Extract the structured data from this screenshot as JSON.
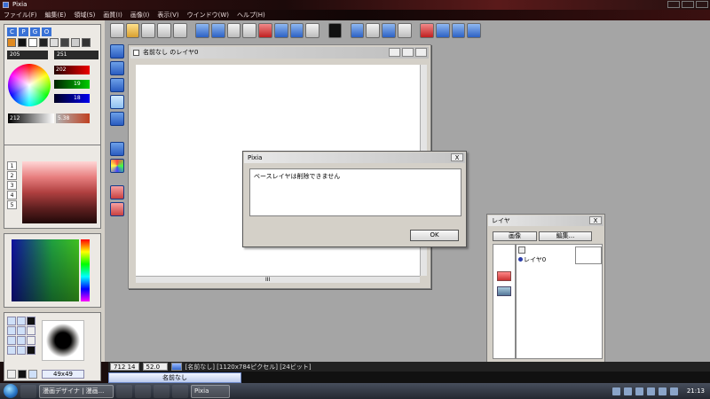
{
  "app": {
    "title": "Pixia"
  },
  "menu": [
    "ファイル(F)",
    "編集(E)",
    "領域(S)",
    "画質(I)",
    "画像(I)",
    "表示(V)",
    "ウインドウ(W)",
    "ヘルプ(H)"
  ],
  "left_panel": {
    "mode_buttons": [
      "C",
      "P",
      "G",
      "O"
    ],
    "field1": "205",
    "field2": "251",
    "rgb": [
      "202",
      "19",
      "18"
    ],
    "gray_value": "212",
    "gray_value2": "5.38",
    "palette_rows": [
      "1",
      "2",
      "3",
      "4",
      "5"
    ],
    "brush_size": "49x49"
  },
  "document": {
    "title": "名前なし のレイヤ0",
    "hscroll_mark": "III"
  },
  "dialog": {
    "title": "Pixia",
    "message": "ベースレイヤは削除できません",
    "ok": "OK",
    "close": "X"
  },
  "layer_window": {
    "title": "レイヤ",
    "btn1": "画像",
    "btn2": "編集...",
    "layer_name": "レイヤ0",
    "close": "X"
  },
  "status": {
    "coords": "712 14",
    "zoom": "52.0",
    "info": "[名前なし] [1120x784ピクセル] [24ビット]"
  },
  "doc_tab": "名前なし",
  "taskbar": {
    "tasks": [
      "漫画デザイナ | 漫画...",
      "Pixia"
    ],
    "time": "21:13"
  }
}
